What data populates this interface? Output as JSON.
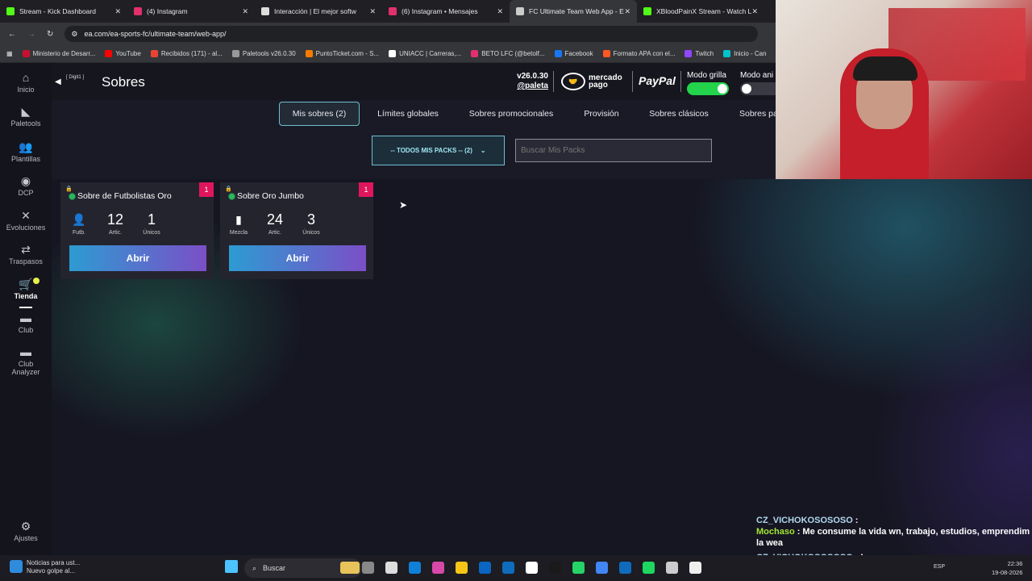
{
  "browser": {
    "tabs": [
      {
        "label": "Stream - Kick Dashboard",
        "color": "#53fc18"
      },
      {
        "label": "(4) Instagram",
        "color": "#e1306c"
      },
      {
        "label": "Interacción | El mejor softw",
        "color": "#dddddd"
      },
      {
        "label": "(6) Instagram • Mensajes",
        "color": "#e1306c"
      },
      {
        "label": "FC Ultimate Team Web App - E",
        "color": "#cccccc",
        "active": true
      },
      {
        "label": "XBloodPainX Stream - Watch L",
        "color": "#53fc18"
      }
    ],
    "url": "ea.com/ea-sports-fc/ultimate-team/web-app/",
    "bookmarks": [
      {
        "label": "Ministerio de Desarr...",
        "color": "#c8102e"
      },
      {
        "label": "YouTube",
        "color": "#ff0000"
      },
      {
        "label": "Recibidos (171) - al...",
        "color": "#ea4335"
      },
      {
        "label": "Paletools v26.0.30",
        "color": "#999999"
      },
      {
        "label": "PuntoTicket.com - S...",
        "color": "#f57c00"
      },
      {
        "label": "UNIACC | Carreras,...",
        "color": "#ffffff"
      },
      {
        "label": "BETO LFC (@betolf...",
        "color": "#e1306c"
      },
      {
        "label": "Facebook",
        "color": "#1877f2"
      },
      {
        "label": "Formato APA con el...",
        "color": "#ff5722"
      },
      {
        "label": "Twitch",
        "color": "#9146ff"
      },
      {
        "label": "Inicio - Can",
        "color": "#00c4cc"
      }
    ]
  },
  "sidebar": {
    "items": [
      {
        "label": "Inicio",
        "icon": "home-icon",
        "glyph": "⌂"
      },
      {
        "label": "Paletools",
        "icon": "paletools-icon",
        "glyph": "◣"
      },
      {
        "label": "Plantillas",
        "icon": "squad-icon",
        "glyph": "👥"
      },
      {
        "label": "DCP",
        "icon": "sbc-icon",
        "glyph": "◉"
      },
      {
        "label": "Evoluciones",
        "icon": "evolutions-icon",
        "glyph": "✕"
      },
      {
        "label": "Traspasos",
        "icon": "transfers-icon",
        "glyph": "⇄"
      },
      {
        "label": "Tienda",
        "icon": "store-icon",
        "glyph": "🛒"
      },
      {
        "label": "Club",
        "icon": "club-icon",
        "glyph": "▬"
      },
      {
        "label": "Club Analyzer",
        "icon": "club-analyzer-icon",
        "glyph": "▬"
      }
    ],
    "settings_label": "Ajustes"
  },
  "header": {
    "user_tag": "[ Digit1 ]",
    "title": "Sobres",
    "version": "v26.0.30",
    "author": "@paleta",
    "mercado_pago": "mercado pago",
    "paypal": "PayPal",
    "grid_mode_label": "Modo grilla",
    "anim_mode_label": "Modo ani"
  },
  "tabs": [
    {
      "label": "Mis sobres (2)",
      "active": true
    },
    {
      "label": "Límites globales"
    },
    {
      "label": "Sobres promocionales"
    },
    {
      "label": "Provisión"
    },
    {
      "label": "Sobres clásicos"
    },
    {
      "label": "Sobres pa"
    }
  ],
  "filter": {
    "selected": "-- TODOS MIS PACKS -- (2)",
    "search_placeholder": "Buscar Mis Packs"
  },
  "packs": [
    {
      "title": "Sobre de Futbolistas Oro",
      "badge": "1",
      "stats": [
        {
          "value": "",
          "label": "Futb.",
          "icon": "player-icon"
        },
        {
          "value": "12",
          "label": "Artic."
        },
        {
          "value": "1",
          "label": "Únicos"
        }
      ],
      "button": "Abrir"
    },
    {
      "title": "Sobre Oro Jumbo",
      "badge": "1",
      "stats": [
        {
          "value": "",
          "label": "Mezcla",
          "icon": "mix-icon"
        },
        {
          "value": "24",
          "label": "Artic."
        },
        {
          "value": "3",
          "label": "Únicos"
        }
      ],
      "button": "Abrir"
    }
  ],
  "chat": {
    "lines": [
      {
        "user": "CZ_VICHOKOSOSOSO",
        "text": ":",
        "color": "#b0d8ee"
      },
      {
        "user": "Mochaso",
        "text": ": Me consume la vida wn, trabajo, estudios, emprendim la wea",
        "color": "#a3e635"
      },
      {
        "user": "CZ_VICHOKOSOSOSO",
        "text": ": Leeme perra",
        "color": "#b0d8ee"
      }
    ]
  },
  "taskbar": {
    "news_title": "Noticias para ust...",
    "news_sub": "Nuevo golpe al...",
    "search_placeholder": "Buscar",
    "lang": "ESP",
    "time": "22:36",
    "date": "19-08-2026"
  }
}
